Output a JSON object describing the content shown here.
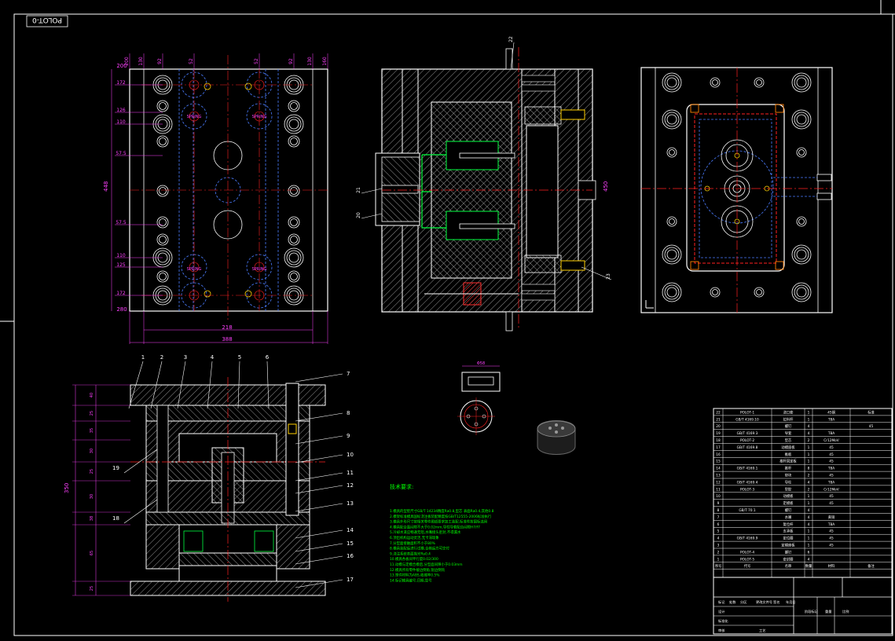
{
  "drawing": {
    "stamp_code": "POLOT-0",
    "colors": {
      "outline": "#ffffff",
      "centerline": "#ff2020",
      "dimension": "#ff40ff",
      "hidden": "#4a7cff",
      "cooling": "#00ff40",
      "note_text": "#00ff00",
      "cyan": "#00d8ff",
      "yellow": "#ffd000",
      "orange": "#ff8000"
    },
    "top_view": {
      "dims_top": [
        "200",
        "130",
        "92",
        "52",
        "52",
        "92",
        "130",
        "160"
      ],
      "dims_left": [
        "172",
        "126",
        "110",
        "57.5",
        "57.5",
        "110",
        "125",
        "172"
      ],
      "dim_height": "448",
      "dim_width_inner": "218",
      "dim_width_outer": "388",
      "dim_corner_top": "200",
      "dim_corner_bottom": "280",
      "cavity_label": "SPRING"
    },
    "section_view": {
      "labels": [
        "22",
        "21",
        "20",
        "23"
      ],
      "side_label": "450"
    },
    "front_section": {
      "part_numbers": [
        "1",
        "2",
        "3",
        "4",
        "5",
        "6",
        "7",
        "8",
        "9",
        "10",
        "11",
        "12",
        "13",
        "14",
        "15",
        "16",
        "17",
        "18",
        "19"
      ],
      "height_dims": [
        "40",
        "25",
        "35",
        "30",
        "25",
        "30",
        "38",
        "65",
        "25"
      ],
      "overall_height": "350"
    },
    "detail_part": {
      "dim": "Φ58"
    },
    "notes": {
      "title": "技术要求:",
      "lines": [
        "1.模具的型腔尺寸GB/T 14234精度Ra0.8,型芯 表面Ra0.4,其他0.8",
        "2.模架标准模具国标浇注板装配精度按GB/T12555-2006标准执行",
        "3.模具外形尺寸按相关零件图纸要求加工装配,标准件按国标选用",
        "4.模具配合面间隙不大于0.02mm,导柱导套配合间隙H7/f7",
        "5.冷却水道应畅通无阻,水嘴接头密封,不得漏水",
        "6.顶出机构运动灵活,无卡滞现象",
        "7.分型面接触面积不小于80%",
        "8.模具装配后进行试模,合格后方可交付",
        "9.浇注系统表面抛光Ra0.4",
        "10.模具各板间平行度0.02/300",
        "11.动模与定模合模后,分型面间隙小于0.03mm",
        "12.模具所有零件棱边倒角,锐边倒钝",
        "13.塑件材料为ABS,收缩率0.5%",
        "14.标记模具编号,日期,型号"
      ]
    },
    "bom": {
      "rows": [
        {
          "no": "22",
          "code": "POLOT-1",
          "name": "浇口套",
          "qty": "1",
          "mat": "45钢",
          "note": "标准"
        },
        {
          "no": "21",
          "code": "GB/T 4169.10",
          "name": "拉料杆",
          "qty": "1",
          "mat": "T8A",
          "note": ""
        },
        {
          "no": "20",
          "code": "",
          "name": "螺钉",
          "qty": "4",
          "mat": "",
          "note": "45"
        },
        {
          "no": "19",
          "code": "GB/T 4169.3",
          "name": "导套",
          "qty": "4",
          "mat": "T8A",
          "note": ""
        },
        {
          "no": "18",
          "code": "POLOT-2",
          "name": "型芯",
          "qty": "2",
          "mat": "Cr12MoV",
          "note": ""
        },
        {
          "no": "17",
          "code": "GB/T 4169.8",
          "name": "动模座板",
          "qty": "1",
          "mat": "45",
          "note": ""
        },
        {
          "no": "16",
          "code": "",
          "name": "推板",
          "qty": "1",
          "mat": "45",
          "note": ""
        },
        {
          "no": "15",
          "code": "",
          "name": "推杆固定板",
          "qty": "1",
          "mat": "45",
          "note": ""
        },
        {
          "no": "14",
          "code": "GB/T 4169.1",
          "name": "推杆",
          "qty": "8",
          "mat": "T8A",
          "note": ""
        },
        {
          "no": "13",
          "code": "",
          "name": "垫块",
          "qty": "2",
          "mat": "45",
          "note": ""
        },
        {
          "no": "12",
          "code": "GB/T 4169.4",
          "name": "导柱",
          "qty": "4",
          "mat": "T8A",
          "note": ""
        },
        {
          "no": "11",
          "code": "POLOT-3",
          "name": "型腔",
          "qty": "2",
          "mat": "Cr12MoV",
          "note": ""
        },
        {
          "no": "10",
          "code": "",
          "name": "动模板",
          "qty": "1",
          "mat": "45",
          "note": ""
        },
        {
          "no": "9",
          "code": "",
          "name": "定模板",
          "qty": "1",
          "mat": "45",
          "note": ""
        },
        {
          "no": "8",
          "code": "GB/T 70.1",
          "name": "螺钉",
          "qty": "4",
          "mat": "",
          "note": ""
        },
        {
          "no": "7",
          "code": "",
          "name": "水嘴",
          "qty": "4",
          "mat": "黄铜",
          "note": ""
        },
        {
          "no": "6",
          "code": "",
          "name": "复位杆",
          "qty": "4",
          "mat": "T8A",
          "note": ""
        },
        {
          "no": "5",
          "code": "",
          "name": "支承板",
          "qty": "1",
          "mat": "45",
          "note": ""
        },
        {
          "no": "4",
          "code": "GB/T 4169.9",
          "name": "定位圈",
          "qty": "1",
          "mat": "45",
          "note": ""
        },
        {
          "no": "3",
          "code": "",
          "name": "定模座板",
          "qty": "1",
          "mat": "45",
          "note": ""
        },
        {
          "no": "2",
          "code": "POLOT-4",
          "name": "螺钉",
          "qty": "6",
          "mat": "",
          "note": ""
        },
        {
          "no": "1",
          "code": "POLOT-5",
          "name": "密封圈",
          "qty": "4",
          "mat": "",
          "note": ""
        }
      ],
      "header": {
        "no": "序号",
        "code": "代号",
        "name": "名称",
        "qty": "数量",
        "mat": "材料",
        "note": "备注"
      },
      "title_cells": [
        "标记",
        "处数",
        "分区",
        "更改文件号",
        "签名",
        "年月日",
        "设计",
        "标准化",
        "审核",
        "工艺",
        "阶段标记",
        "重量",
        "比例"
      ]
    }
  }
}
